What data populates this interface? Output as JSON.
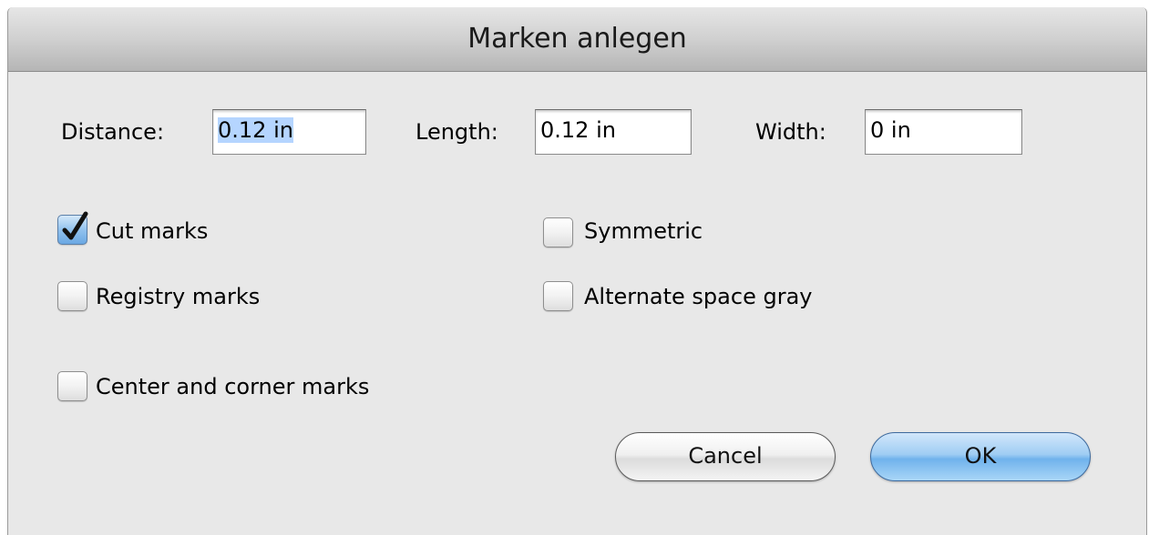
{
  "dialog": {
    "title": "Marken anlegen"
  },
  "fields": {
    "distance": {
      "label": "Distance:",
      "value": "0.12 in",
      "selected": true
    },
    "length": {
      "label": "Length:",
      "value": "0.12 in"
    },
    "width": {
      "label": "Width:",
      "value": "0 in"
    }
  },
  "options": {
    "cut_marks": {
      "label": "Cut marks",
      "checked": true
    },
    "symmetric": {
      "label": "Symmetric",
      "checked": false
    },
    "registry_marks": {
      "label": "Registry marks",
      "checked": false
    },
    "alternate_space_gray": {
      "label": "Alternate space gray",
      "checked": false
    },
    "center_and_corner_marks": {
      "label": "Center and corner marks",
      "checked": false
    }
  },
  "buttons": {
    "cancel": "Cancel",
    "ok": "OK"
  },
  "colors": {
    "selection_highlight": "#b5d5ff",
    "default_button": "#70b2ec",
    "checkbox_checked": "#92c2ee"
  }
}
